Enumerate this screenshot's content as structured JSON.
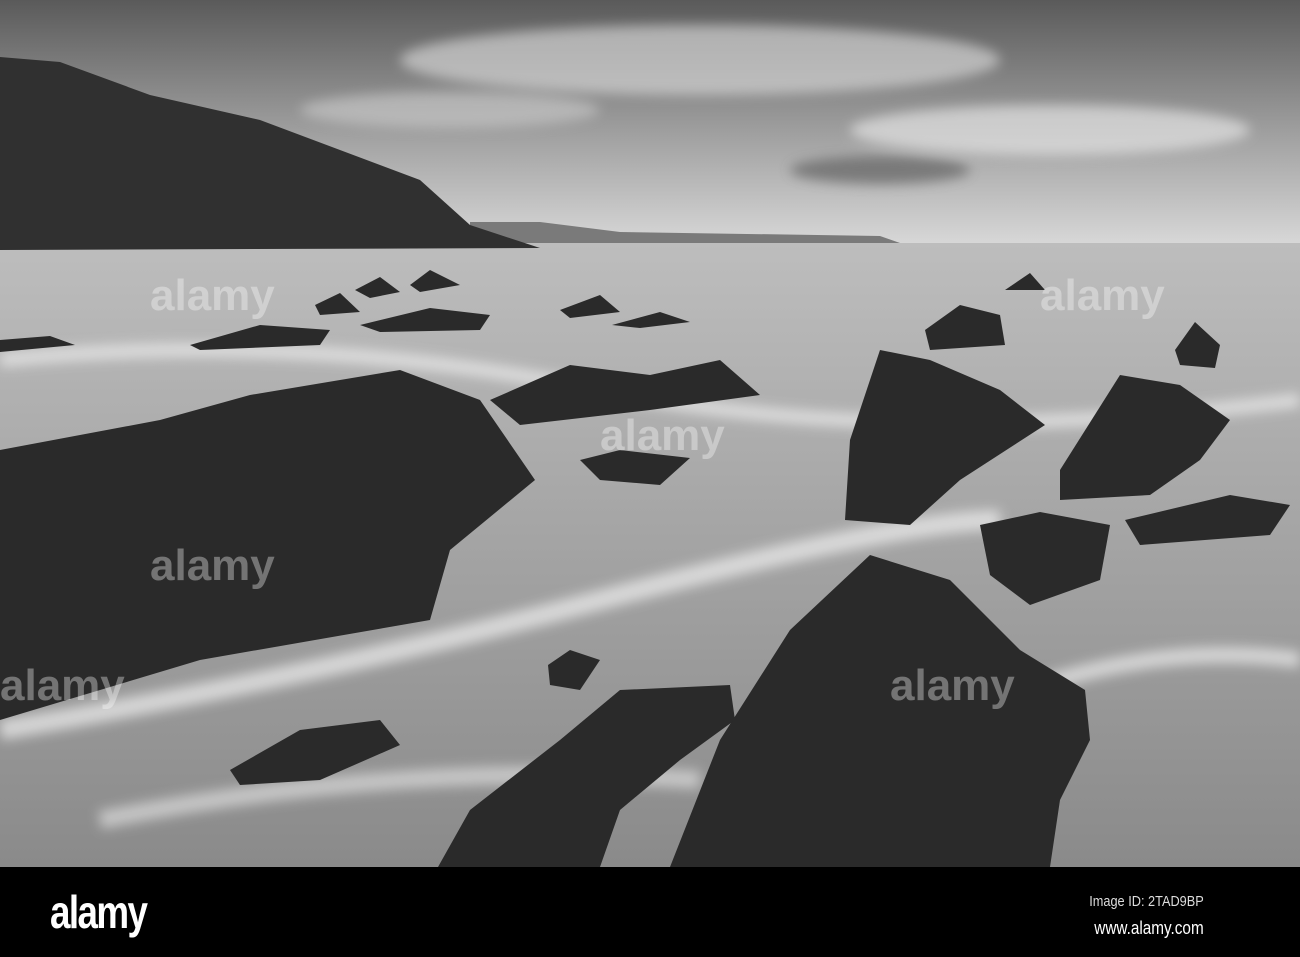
{
  "photo": {
    "subject": "Black and white long-exposure seascape with jagged rocks, misty water and headland cliff"
  },
  "footer": {
    "logo": "alamy",
    "image_id": "Image ID: 2TAD9BP",
    "url": "www.alamy.com"
  }
}
